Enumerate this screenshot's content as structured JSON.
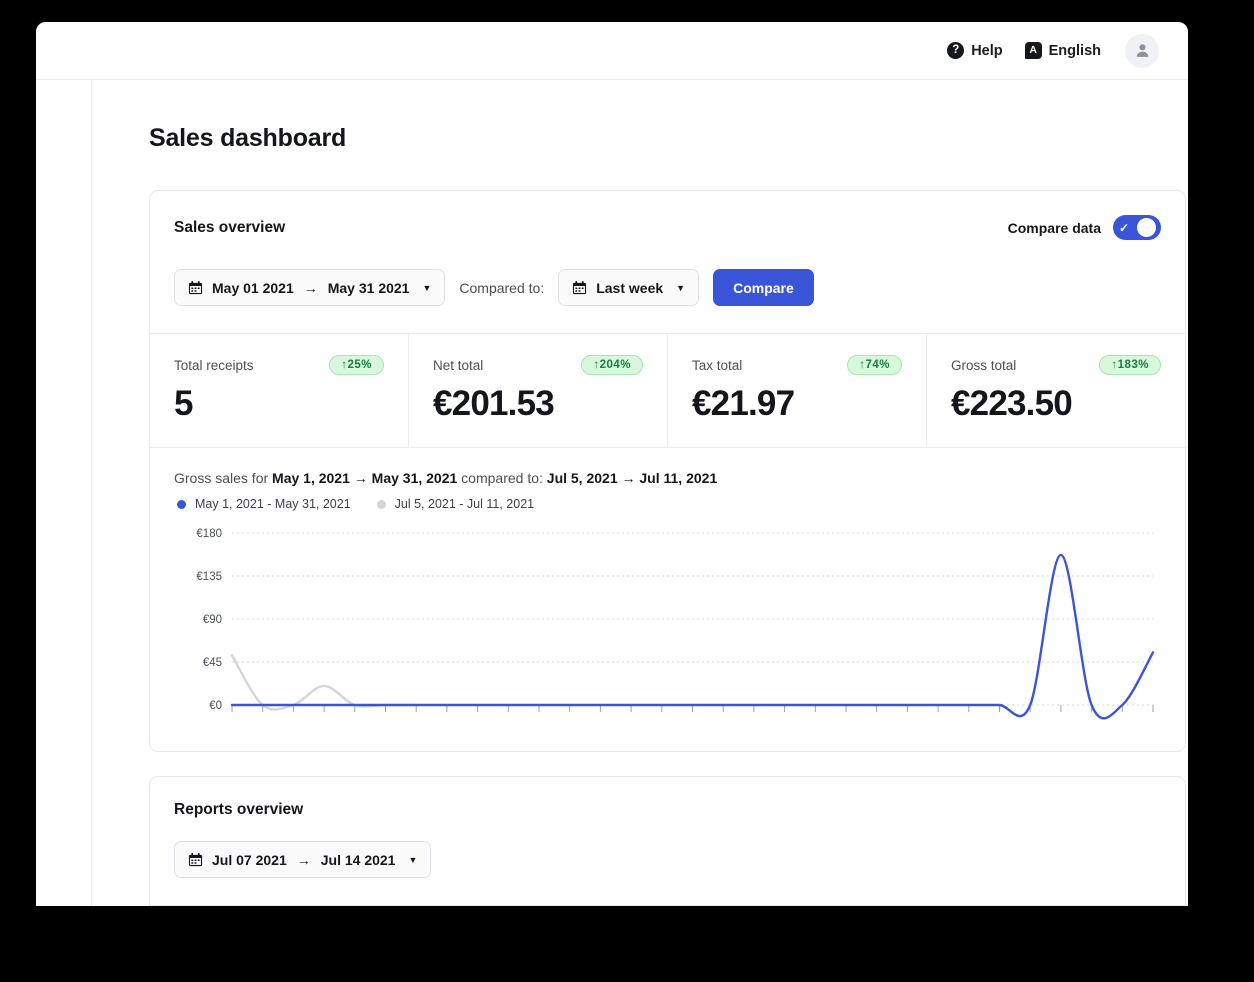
{
  "topbar": {
    "help_label": "Help",
    "help_icon": "question-mark-circle-icon",
    "language_label": "English",
    "language_icon": "translate-icon",
    "language_glyph": "A",
    "help_glyph": "?",
    "avatar_icon": "user-avatar-icon"
  },
  "page": {
    "title": "Sales dashboard"
  },
  "sales_overview": {
    "title": "Sales overview",
    "compare_data_label": "Compare data",
    "compare_data_on": true,
    "date_range": {
      "start": "May 01 2021",
      "end": "May 31 2021",
      "arrow": "→",
      "caret": "▼",
      "icon": "calendar-icon"
    },
    "compared_to_label": "Compared to:",
    "compare_preset": {
      "value": "Last week",
      "caret": "▼",
      "icon": "calendar-icon"
    },
    "compare_button_label": "Compare",
    "kpis": [
      {
        "label": "Total receipts",
        "value": "5",
        "badge": "↑25%",
        "trend": "up"
      },
      {
        "label": "Net total",
        "value": "€201.53",
        "badge": "↑204%",
        "trend": "up"
      },
      {
        "label": "Tax total",
        "value": "€21.97",
        "badge": "↑74%",
        "trend": "up"
      },
      {
        "label": "Gross total",
        "value": "€223.50",
        "badge": "↑183%",
        "trend": "up"
      }
    ],
    "chart_caption": {
      "prefix": "Gross sales for",
      "primary_start": "May 1, 2021",
      "arrow": "→",
      "primary_end": "May 31, 2021",
      "middle": "compared to:",
      "compare_start": "Jul 5, 2021",
      "compare_end": "Jul 11, 2021"
    }
  },
  "reports_overview": {
    "title": "Reports overview",
    "date_range": {
      "start": "Jul 07 2021",
      "end": "Jul 14 2021",
      "arrow": "→",
      "caret": "▼",
      "icon": "calendar-icon"
    }
  },
  "colors": {
    "accent": "#3b55d9",
    "primary_series": "#3b55d9",
    "compare_series": "#d2d5dc",
    "badge_bg": "#d7f8da",
    "badge_text": "#14803c",
    "grid": "#d6d8de"
  },
  "chart_data": {
    "type": "line",
    "title": "Gross sales for May 1, 2021 → May 31, 2021 compared to: Jul 5, 2021 → Jul 11, 2021",
    "xlabel": "",
    "ylabel": "",
    "ylim": [
      0,
      180
    ],
    "yticks": [
      0,
      45,
      90,
      135,
      180
    ],
    "ytick_labels": [
      "€0",
      "€45",
      "€90",
      "€135",
      "€180"
    ],
    "grid": true,
    "legend_position": "top-left",
    "x_tick_count": 31,
    "x_tick_labels": [],
    "series": [
      {
        "name": "May 1, 2021 - May 31, 2021",
        "color": "#3b55d9",
        "values": [
          0,
          0,
          0,
          0,
          0,
          0,
          0,
          0,
          0,
          0,
          0,
          0,
          0,
          0,
          0,
          0,
          0,
          0,
          0,
          0,
          0,
          0,
          0,
          0,
          0,
          0,
          0,
          157,
          0,
          0,
          55
        ]
      },
      {
        "name": "Jul 5, 2021 - Jul 11, 2021",
        "color": "#d2d5dc",
        "values": [
          52,
          0,
          0,
          20,
          0,
          0,
          0
        ]
      }
    ]
  }
}
